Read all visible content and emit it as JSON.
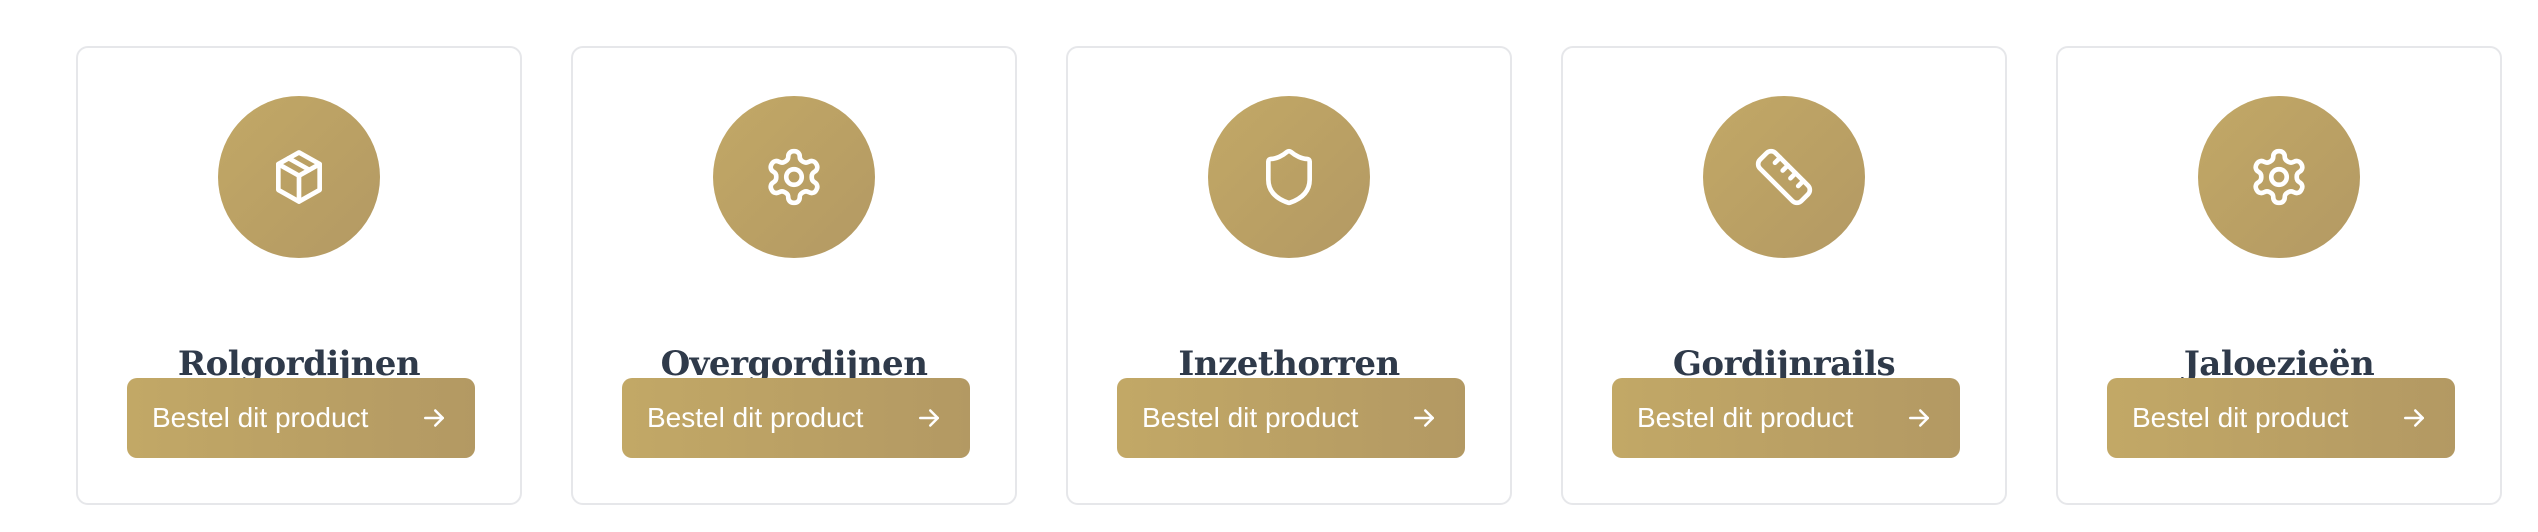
{
  "colors": {
    "accent": "#bba165",
    "title": "#2f3a4a",
    "card_border": "#e6e7ea"
  },
  "cards": [
    {
      "title": "Rolgordijnen",
      "icon": "box-icon",
      "button_label": "Bestel dit product"
    },
    {
      "title": "Overgordijnen",
      "icon": "gear-icon",
      "button_label": "Bestel dit product"
    },
    {
      "title": "Inzethorren",
      "icon": "shield-icon",
      "button_label": "Bestel dit product"
    },
    {
      "title": "Gordijnrails",
      "icon": "ruler-icon",
      "button_label": "Bestel dit product"
    },
    {
      "title": "Jaloezieën",
      "icon": "gear-icon",
      "button_label": "Bestel dit product"
    }
  ]
}
